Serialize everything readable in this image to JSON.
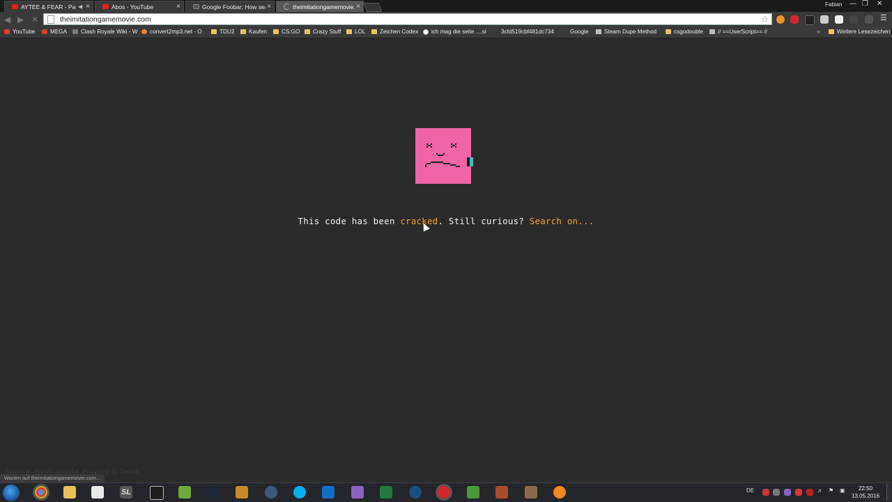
{
  "tabs": [
    {
      "label": "AYTEE & FEAR - Parag",
      "favicon": "youtube-icon",
      "audio": true
    },
    {
      "label": "Abos - YouTube",
      "favicon": "youtube-icon"
    },
    {
      "label": "Google Foobar: How sear",
      "favicon": "google-icon"
    },
    {
      "label": "theimitationgamemovie.c",
      "favicon": "loading-icon",
      "active": true
    }
  ],
  "profile_name": "Fabian",
  "address": {
    "url": "theimitationgamemovie.com"
  },
  "bookmarks": [
    {
      "label": "YouTube",
      "icon": "youtube-icon"
    },
    {
      "label": "MEGA",
      "icon": "mega-icon"
    },
    {
      "label": "Clash Royale Wiki - W",
      "icon": "wiki-icon"
    },
    {
      "label": "convert2mp3.net - O",
      "icon": "convert-icon"
    },
    {
      "label": "TDU2",
      "icon": "folder-icon"
    },
    {
      "label": "Kaufen",
      "icon": "folder-icon"
    },
    {
      "label": "CS:GO",
      "icon": "folder-icon"
    },
    {
      "label": "Crazy Stuff",
      "icon": "folder-icon"
    },
    {
      "label": "LOL",
      "icon": "folder-icon"
    },
    {
      "label": "Zeichen Codex",
      "icon": "folder-icon"
    },
    {
      "label": "ich mag die seite ....si",
      "icon": "google-icon"
    },
    {
      "label": "3cfd519cbf481dc734",
      "icon": "page-icon"
    },
    {
      "label": "Google",
      "icon": "page-icon"
    },
    {
      "label": "Steam Dupe Method",
      "icon": "grid-icon"
    },
    {
      "label": "csgodouble",
      "icon": "folder-icon"
    },
    {
      "label": "// ==UserScript== //",
      "icon": "grid-icon"
    },
    {
      "label": "Weitere Lesezeichen",
      "icon": "folder-icon"
    }
  ],
  "page": {
    "message_prefix": "This code has been ",
    "cracked_link": "cracked",
    "message_middle": ". Still curious? ",
    "search_link": "Search on...",
    "footer_faint": "Google    About Google    Privacy & Terms"
  },
  "status": "Warten auf theimitationgamemovie.com...",
  "taskbar": {
    "language": "DE",
    "time": "22:50",
    "date": "13.05.2016"
  },
  "colors": {
    "page_bg": "#2b2b2b",
    "sad_face": "#ef65a6",
    "link": "#f0a030",
    "cursor_teal": "#3ebfb8"
  }
}
